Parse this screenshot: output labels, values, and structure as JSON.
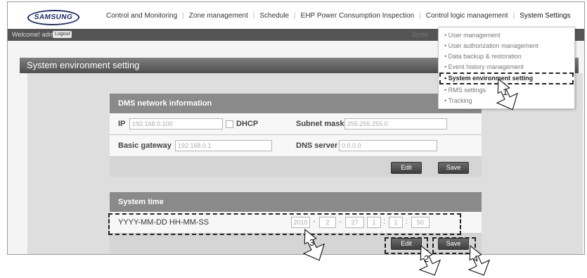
{
  "brand": {
    "logo_text": "SAMSUNG"
  },
  "nav": {
    "items": [
      "Control and Monitoring",
      "Zone management",
      "Schedule",
      "EHP Power Consumption Inspection",
      "Control logic management",
      "System Settings"
    ]
  },
  "welcome": {
    "text": "Welcome! admin,",
    "logout": "Logout",
    "right_text": "Syste"
  },
  "page": {
    "title": "System environment setting"
  },
  "network": {
    "header": "DMS network information",
    "ip_label": "IP",
    "ip_value": "192.168.0.100",
    "dhcp_label": "DHCP",
    "subnet_label": "Subnet mask",
    "subnet_value": "255.255.255.0",
    "gateway_label": "Basic gateway",
    "gateway_value": "192.168.0.1",
    "dns_label": "DNS server",
    "dns_value": "0.0.0.0",
    "edit_label": "Edit",
    "save_label": "Save"
  },
  "time": {
    "header": "System time",
    "format_label": "YYYY-MM-DD HH-MM-SS",
    "year": "2010",
    "month": "2",
    "day": "27",
    "hour": "1",
    "minute": "1",
    "second": "50",
    "dash": "-",
    "colon": ":",
    "edit_label": "Edit",
    "save_label": "Save"
  },
  "dropdown": {
    "items": [
      "• User management",
      "• User authorization management",
      "• Data backup & restoration",
      "• Event history management",
      "• System environment setting",
      "• RMS settings",
      "• Tracking"
    ]
  },
  "callouts": {
    "one": "1",
    "two": "2",
    "three": "3",
    "four": "4"
  }
}
